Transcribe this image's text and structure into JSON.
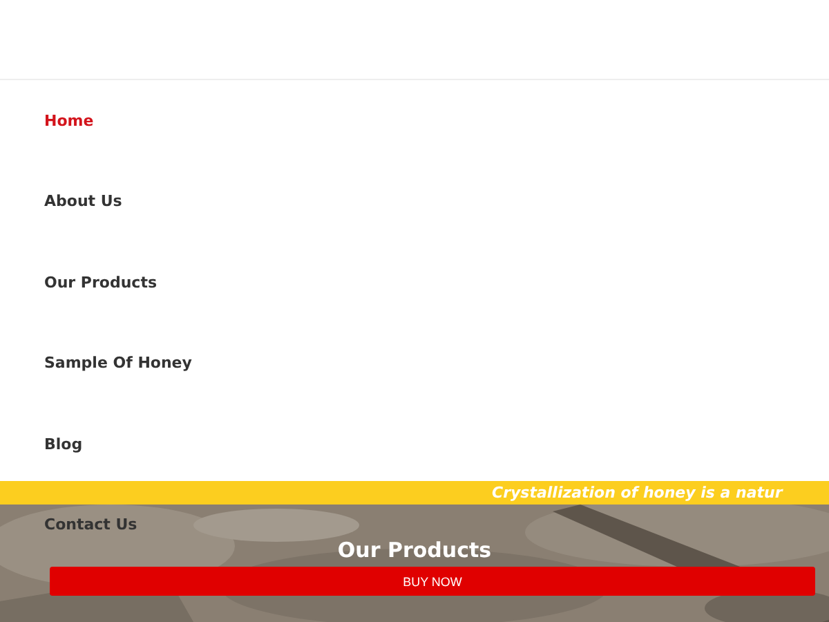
{
  "nav": {
    "items": [
      {
        "label": "Home",
        "selected": true
      },
      {
        "label": "About Us",
        "selected": false
      },
      {
        "label": "Our Products",
        "selected": false
      },
      {
        "label": "Sample Of Honey",
        "selected": false
      },
      {
        "label": "Blog",
        "selected": false
      },
      {
        "label": "Contact Us",
        "selected": false
      }
    ]
  },
  "ticker": {
    "text": "Crystallization of honey is a natur"
  },
  "hero": {
    "heading": "Our Products"
  },
  "buy_button": {
    "label": "BUY NOW"
  }
}
